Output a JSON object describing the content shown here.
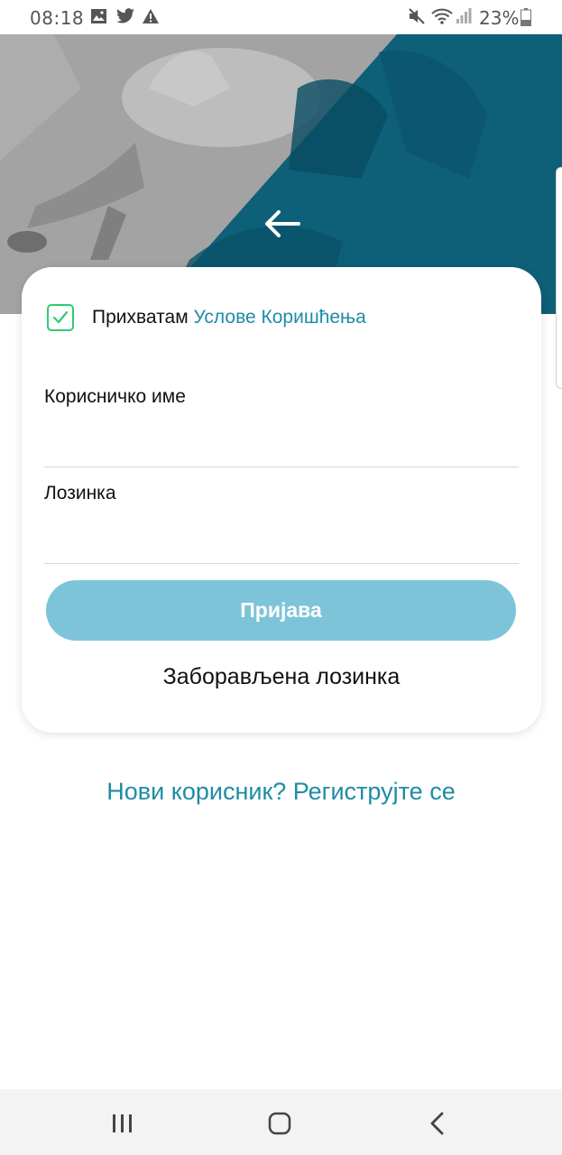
{
  "status_bar": {
    "time": "08:18",
    "battery_percent": "23%",
    "icons": [
      "image-icon",
      "twitter-icon",
      "warning-icon",
      "mute-icon",
      "wifi-icon",
      "signal-icon",
      "battery-icon"
    ]
  },
  "hero": {
    "back_icon": "arrow-left-icon"
  },
  "login_card": {
    "accept_prefix": "Прихватам",
    "terms_link": "Услове Коришћења",
    "terms_checked": true,
    "username_label": "Корисничко име",
    "username_value": "",
    "password_label": "Лозинка",
    "password_value": "",
    "login_button": "Пријава",
    "forgot_password": "Заборављена лозинка"
  },
  "register_link": "Нови корисник? Региструјте се",
  "colors": {
    "accent": "#1e8ca6",
    "button": "#7ec4d8",
    "checkbox": "#2ecc71",
    "hero_blue": "#0e5f78"
  },
  "nav_bar": {
    "icons": [
      "recent-apps-icon",
      "home-icon",
      "back-nav-icon"
    ]
  }
}
